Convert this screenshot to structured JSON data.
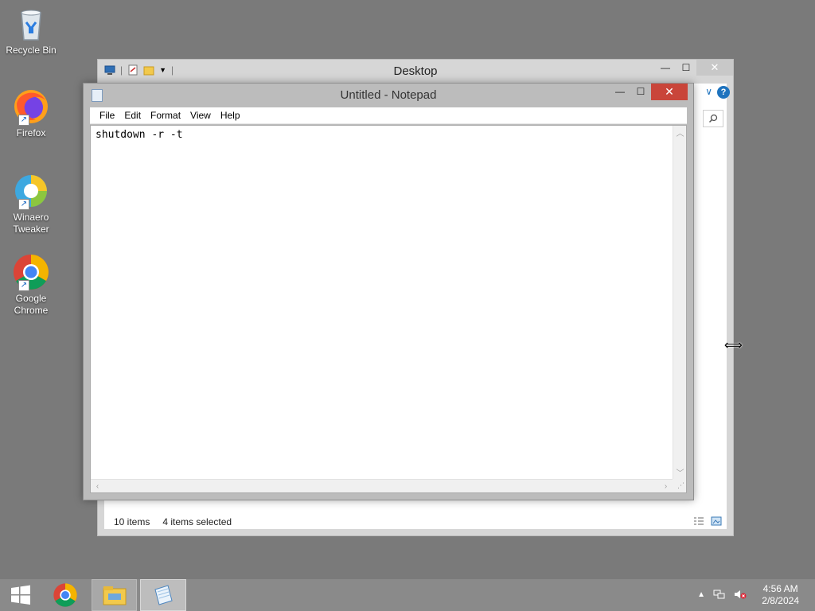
{
  "desktop": {
    "icons": [
      {
        "label": "Recycle Bin"
      },
      {
        "label": "Firefox"
      },
      {
        "label": "Winaero Tweaker"
      },
      {
        "label": "Google Chrome"
      }
    ]
  },
  "explorer": {
    "title": "Desktop",
    "status_items": "10 items",
    "status_selected": "4 items selected"
  },
  "notepad": {
    "title": "Untitled - Notepad",
    "menu": [
      "File",
      "Edit",
      "Format",
      "View",
      "Help"
    ],
    "content": "shutdown -r -t"
  },
  "taskbar": {
    "time": "4:56 AM",
    "date": "2/8/2024"
  },
  "colors": {
    "close_active": "#c9453a",
    "taskbar": "#8a8a8a",
    "desktop": "#7a7a7a"
  }
}
